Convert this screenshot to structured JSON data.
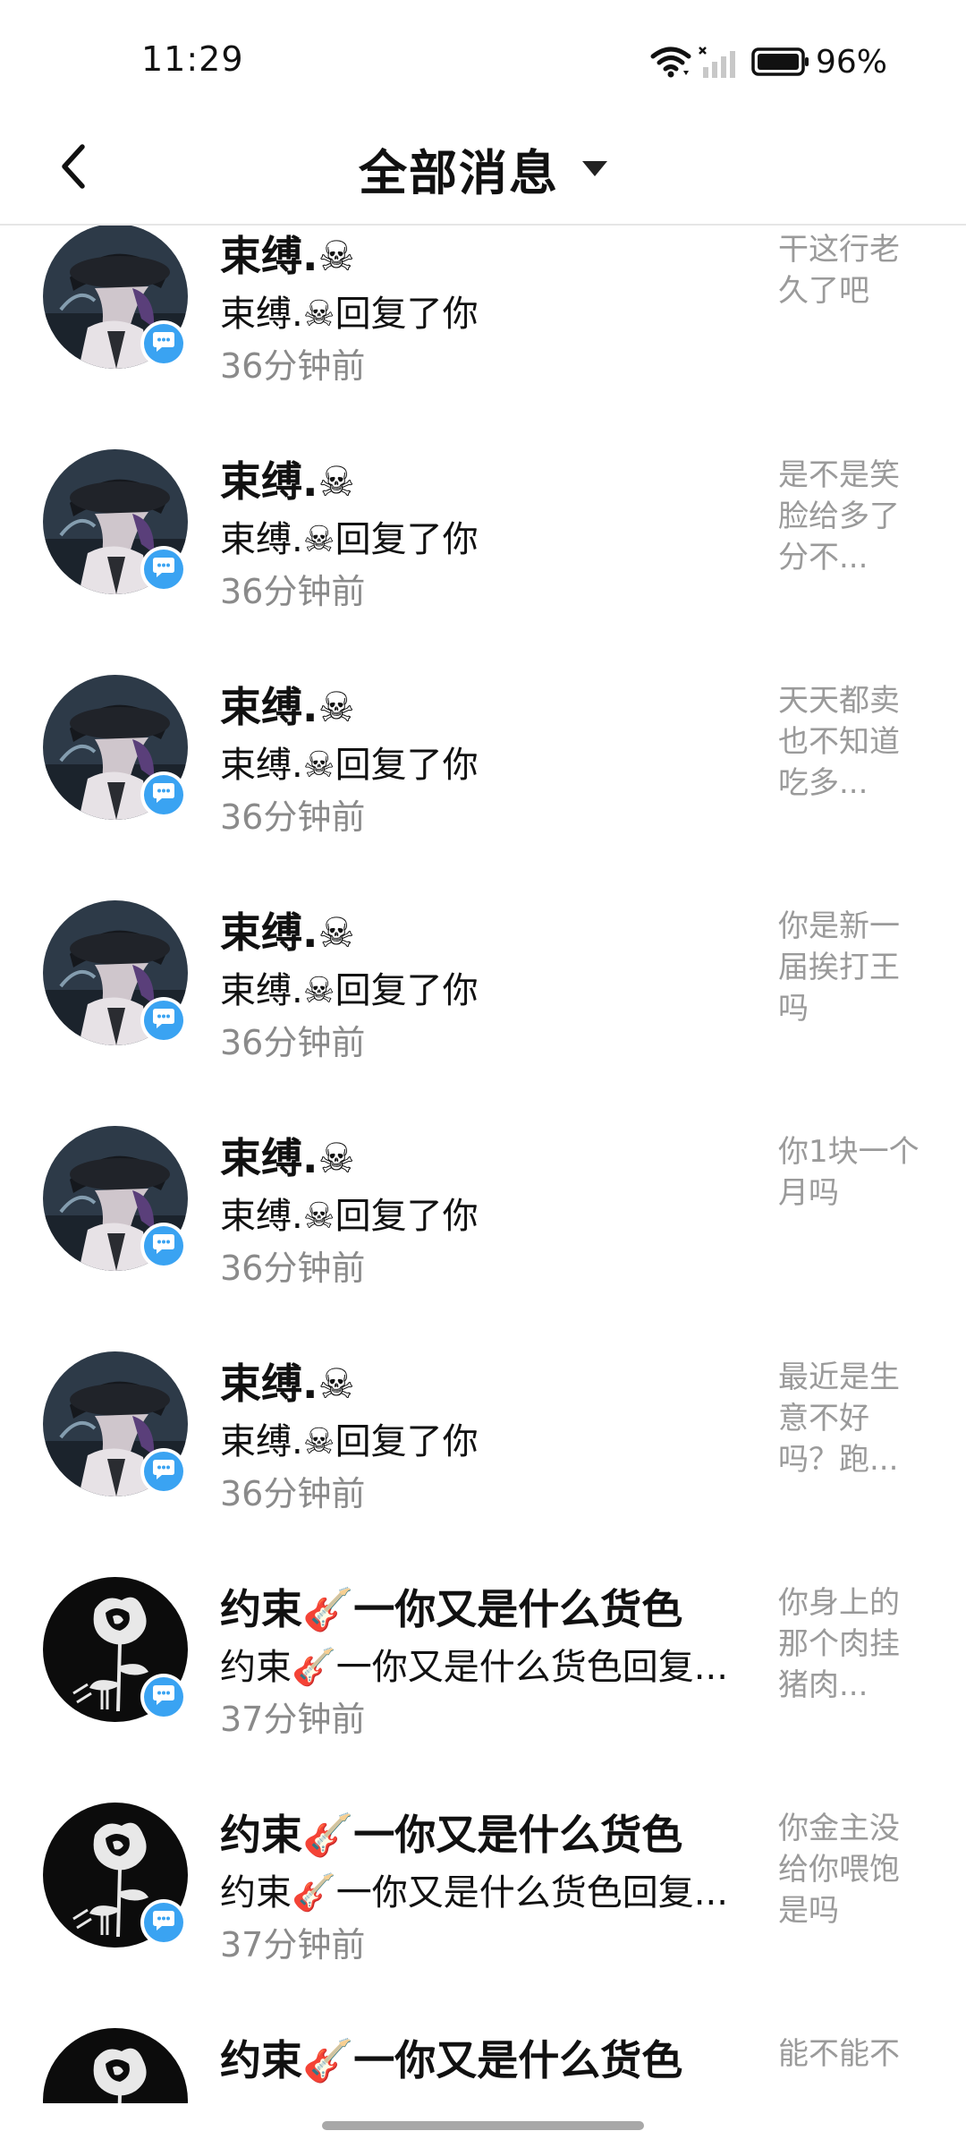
{
  "status_bar": {
    "time": "11:29",
    "battery": "96%",
    "icons": [
      "wifi-icon",
      "cellular-signal-icon",
      "battery-icon"
    ]
  },
  "header": {
    "back_icon": "chevron-left-icon",
    "title": "全部消息",
    "dropdown_icon": "caret-down-icon"
  },
  "messages": [
    {
      "avatar": "avatar-anime-boy",
      "name": "束缚.☠",
      "action": "束缚.☠回复了你",
      "time": "36分钟前",
      "preview": "干这行老久了吧"
    },
    {
      "avatar": "avatar-anime-boy",
      "name": "束缚.☠",
      "action": "束缚.☠回复了你",
      "time": "36分钟前",
      "preview": "是不是笑脸给多了分不..."
    },
    {
      "avatar": "avatar-anime-boy",
      "name": "束缚.☠",
      "action": "束缚.☠回复了你",
      "time": "36分钟前",
      "preview": "天天都卖也不知道吃多..."
    },
    {
      "avatar": "avatar-anime-boy",
      "name": "束缚.☠",
      "action": "束缚.☠回复了你",
      "time": "36分钟前",
      "preview": "你是新一届挨打王吗"
    },
    {
      "avatar": "avatar-anime-boy",
      "name": "束缚.☠",
      "action": "束缚.☠回复了你",
      "time": "36分钟前",
      "preview": "你1块一个月吗"
    },
    {
      "avatar": "avatar-anime-boy",
      "name": "束缚.☠",
      "action": "束缚.☠回复了你",
      "time": "36分钟前",
      "preview": "最近是生意不好吗？跑..."
    },
    {
      "avatar": "avatar-rose",
      "name": "约束🎸一你又是什么货色",
      "action": "约束🎸一你又是什么货色回复...",
      "time": "37分钟前",
      "preview": "你身上的那个肉挂猪肉..."
    },
    {
      "avatar": "avatar-rose",
      "name": "约束🎸一你又是什么货色",
      "action": "约束🎸一你又是什么货色回复...",
      "time": "37分钟前",
      "preview": "你金主没给你喂饱是吗"
    },
    {
      "avatar": "avatar-rose",
      "name": "约束🎸一你又是什么货色",
      "action": "",
      "time": "",
      "preview": "能不能不"
    }
  ],
  "badge_icon": "comment-bubble-icon"
}
